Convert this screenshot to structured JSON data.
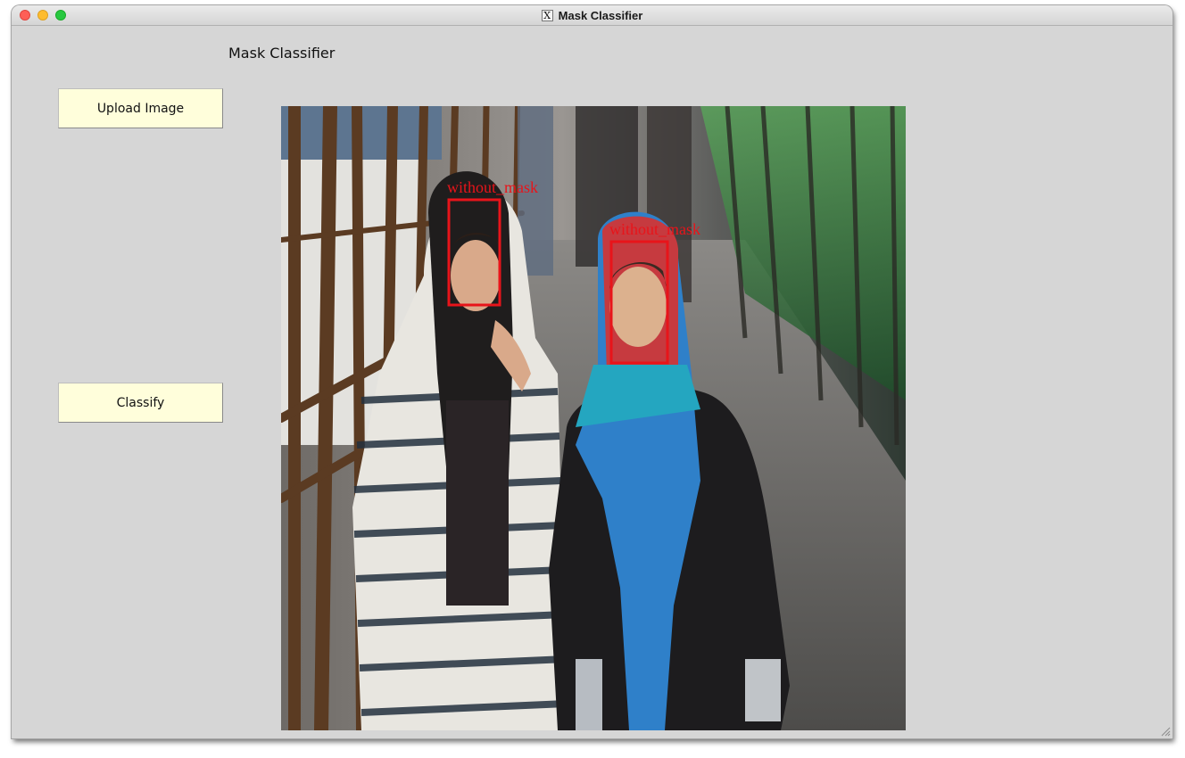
{
  "window": {
    "title": "Mask Classifier",
    "title_icon": "x11-icon"
  },
  "app": {
    "heading": "Mask Classifier"
  },
  "buttons": {
    "upload_label": "Upload Image",
    "classify_label": "Classify"
  },
  "image": {
    "description_icon": "photo-two-women-in-headscarves",
    "detections": [
      {
        "label": "without_mask",
        "color": "#e8141a"
      },
      {
        "label": "without_mask",
        "color": "#e8141a"
      }
    ]
  },
  "colors": {
    "window_bg": "#d6d6d6",
    "button_bg": "#fffedb",
    "box": "#e8141a"
  }
}
